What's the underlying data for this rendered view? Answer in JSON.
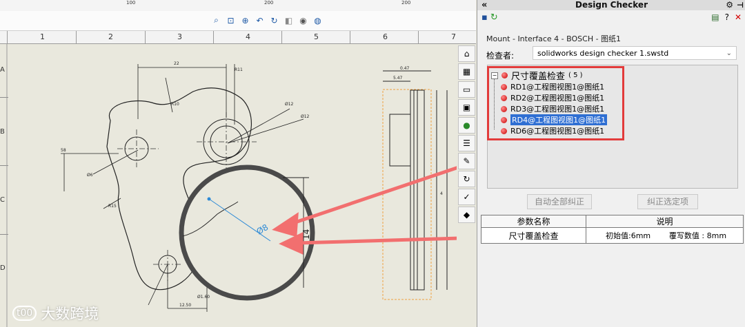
{
  "ruler": {
    "ticks": [
      "100",
      "200",
      "200"
    ]
  },
  "drawing_tools": {
    "icons": [
      "zoom-to-fit-icon",
      "zoom-area-icon",
      "zoom-in-out-icon",
      "previous-view-icon",
      "rotate-icon",
      "display-style-icon",
      "hide-show-icon",
      "appearance-icon"
    ]
  },
  "columns": [
    "1",
    "2",
    "3",
    "4",
    "5",
    "6",
    "7"
  ],
  "rows": [
    "A",
    "B",
    "C",
    "D"
  ],
  "dimensions": {
    "d1": "22",
    "d2": "R11",
    "d3": "R10",
    "d4": "Ø12",
    "d5": "Ø12",
    "d6": "R15",
    "d7": "Ø6",
    "d8": "Ø1.60",
    "d9": "12.50",
    "d10": "0.47",
    "d11": "5.47",
    "d12": "4",
    "d13": "Ø8",
    "d14": "14",
    "d15": "58"
  },
  "task_pane": {
    "icons": [
      "home-icon",
      "parts-icon",
      "folder-icon",
      "view-palette-icon",
      "appearances-icon",
      "custom-properties-icon",
      "forum-icon",
      "refresh-icon",
      "design-checker-icon",
      "library-icon"
    ]
  },
  "watermark": {
    "logo": "t00",
    "text": "大数跨境"
  },
  "panel": {
    "title": "Design Checker",
    "document": "Mount - Interface 4 - BOSCH - 图纸1",
    "checker_label": "检查者:",
    "checker_value": "solidworks design checker 1.swstd",
    "tree": {
      "root": "尺寸覆盖检查",
      "root_count": "( 5 )",
      "items": [
        "RD1@工程图视图1@图纸1",
        "RD2@工程图视图1@图纸1",
        "RD3@工程图视图1@图纸1",
        "RD4@工程图视图1@图纸1",
        "RD6@工程图视图1@图纸1"
      ]
    },
    "buttons": {
      "fix_all": "自动全部纠正",
      "fix_selected": "纠正选定项"
    },
    "table": {
      "headers": [
        "参数名称",
        "说明"
      ],
      "row": {
        "name": "尺寸覆盖检查",
        "initial": "初始值:6mm",
        "override": "覆写数值 : 8mm"
      }
    }
  }
}
